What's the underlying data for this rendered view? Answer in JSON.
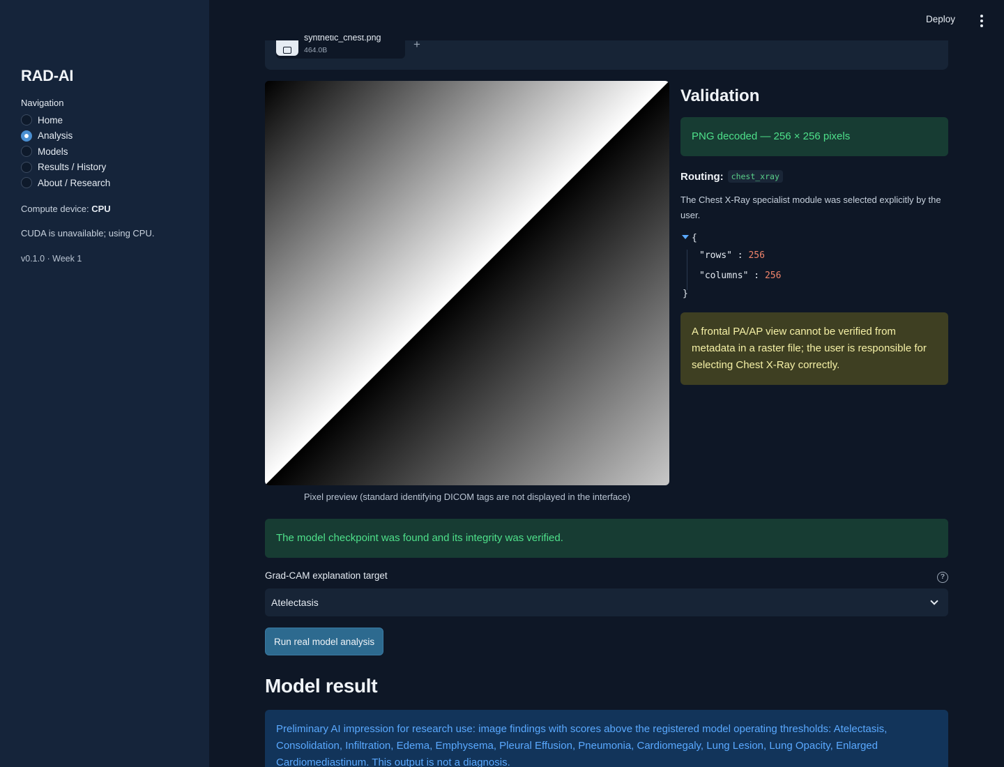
{
  "sidebar": {
    "title": "RAD-AI",
    "nav_label": "Navigation",
    "items": [
      {
        "label": "Home",
        "checked": false
      },
      {
        "label": "Analysis",
        "checked": true
      },
      {
        "label": "Models",
        "checked": false
      },
      {
        "label": "Results / History",
        "checked": false
      },
      {
        "label": "About / Research",
        "checked": false
      }
    ],
    "compute_prefix": "Compute device:",
    "compute_value": "CPU",
    "cuda_note": "CUDA is unavailable; using CPU.",
    "version": "v0.1.0 · Week 1"
  },
  "topbar": {
    "deploy_label": "Deploy",
    "menu_icon": "kebab-menu-icon"
  },
  "uploader": {
    "file_name": "synthetic_chest.png",
    "file_size": "464.0B",
    "add_label": "+"
  },
  "preview": {
    "caption": "Pixel preview (standard identifying DICOM tags are not displayed in the interface)"
  },
  "validation": {
    "heading": "Validation",
    "decoded_message": "PNG decoded — 256 × 256 pixels",
    "routing_label": "Routing:",
    "routing_value": "chest_xray",
    "routing_description": "The Chest X-Ray specialist module was selected explicitly by the user.",
    "json": {
      "open": "{",
      "close": "}",
      "rows_key": "\"rows\"",
      "rows_value": "256",
      "columns_key": "\"columns\"",
      "columns_value": "256"
    },
    "warning": "A frontal PA/AP view cannot be verified from metadata in a raster file; the user is responsible for selecting Chest X-Ray correctly."
  },
  "checkpoint": {
    "message": "The model checkpoint was found and its integrity was verified."
  },
  "gradcam": {
    "label": "Grad-CAM explanation target",
    "help_icon": "?",
    "selected": "Atelectasis"
  },
  "run_button": "Run real model analysis",
  "model_result": {
    "heading": "Model result",
    "impression": "Preliminary AI impression for research use: image findings with scores above the registered model operating thresholds: Atelectasis, Consolidation, Infiltration, Edema, Emphysema, Pleural Effusion, Pneumonia, Cardiomegaly, Lung Lesion, Lung Opacity, Enlarged Cardiomediastinum. This output is not a diagnosis."
  },
  "colors": {
    "background": "#0e1726",
    "sidebar": "#15243a",
    "success_bg": "#173c33",
    "success_text": "#4ee08a",
    "warning_bg": "#3e3f22",
    "warning_text": "#f6f1a6",
    "info_bg": "#12345a",
    "info_text": "#5aa9ff",
    "primary_button": "#2d6a8f"
  }
}
